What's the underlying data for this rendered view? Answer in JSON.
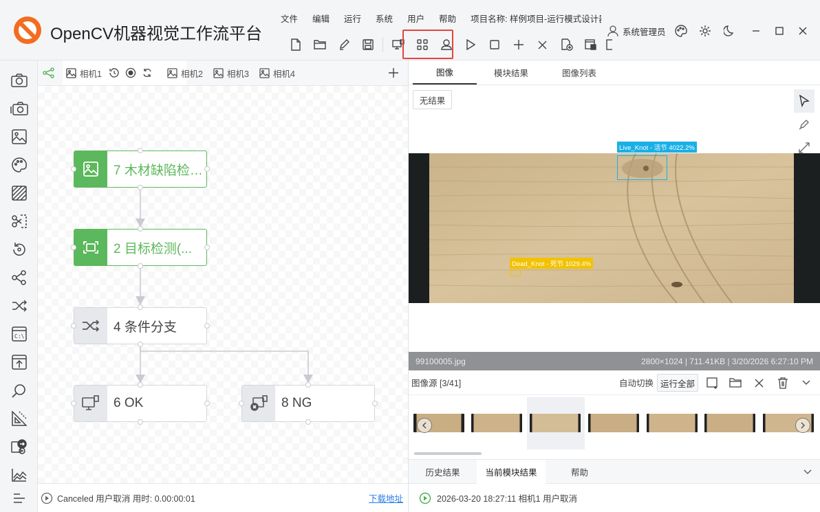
{
  "app": {
    "title": "OpenCV机器视觉工作流平台",
    "project": "项目名称: 样例项目-运行模式设计器"
  },
  "menu": [
    "文件",
    "编辑",
    "运行",
    "系统",
    "用户",
    "帮助"
  ],
  "user": {
    "name": "系统管理员"
  },
  "canvas_tabs": [
    {
      "label": "相机1",
      "active": true
    },
    {
      "label": "相机2"
    },
    {
      "label": "相机3"
    },
    {
      "label": "相机4"
    }
  ],
  "nodes": [
    {
      "id": "n7",
      "label": "7 木材缺陷检测...",
      "status": "success",
      "icon": "image-icon"
    },
    {
      "id": "n2",
      "label": "2 目标检测(...",
      "status": "success",
      "icon": "target-icon"
    },
    {
      "id": "n4",
      "label": "4 条件分支",
      "status": "idle",
      "icon": "shuffle-icon"
    },
    {
      "id": "n6",
      "label": "6 OK",
      "status": "idle",
      "icon": "monitor-icon"
    },
    {
      "id": "n8",
      "label": "8 NG",
      "status": "idle",
      "icon": "monitor-error-icon"
    }
  ],
  "canvas_status": {
    "text": "Canceled 用户取消 用时: 0.00:00:01",
    "link": "下载地址"
  },
  "right_tabs": [
    {
      "label": "图像",
      "active": true
    },
    {
      "label": "模块结果"
    },
    {
      "label": "图像列表"
    }
  ],
  "viewer": {
    "no_result": "无结果",
    "detections": [
      {
        "label": "Live_Knot - 活节 4022.2%",
        "color": "#1ab0e6"
      },
      {
        "label": "Dead_Knot - 死节 1029.4%",
        "color": "#f2c200"
      }
    ],
    "file_name": "99100005.jpg",
    "file_info": "2800×1024 | 711.41KB | 3/20/2026 6:27:10 PM"
  },
  "image_source": {
    "label": "图像源 [3/41]",
    "auto_switch": "自动切换",
    "run_all": "运行全部"
  },
  "bottom_tabs": [
    {
      "label": "历史结果"
    },
    {
      "label": "当前模块结果",
      "active": true
    },
    {
      "label": "帮助"
    }
  ],
  "log": {
    "text": "2026-03-20 18:27:11  相机1 用户取消"
  },
  "colors": {
    "accent_green": "#5cb85c",
    "highlight_red": "#e2453c",
    "link_blue": "#2b7de9"
  }
}
